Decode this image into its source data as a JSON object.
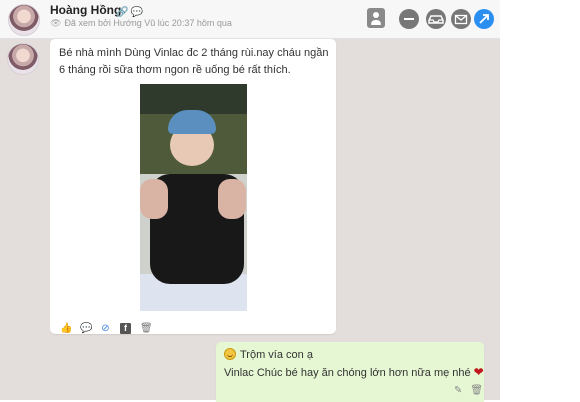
{
  "header": {
    "name": "Hoàng Hồng",
    "seen_text": "Đã xem bởi Hướng Vũ lúc 20:37 hôm qua",
    "icons": {
      "link": "link-icon",
      "contact_card": "contact-card-icon",
      "minus": "minus-icon",
      "inbox": "inbox-icon",
      "mail": "mail-icon",
      "open": "open-external-icon"
    }
  },
  "messages": {
    "incoming": {
      "text": "Bé nhà mình Dùng Vinlac đc 2 tháng rùi.nay cháu ngần 6 tháng rồi sữa thơm ngon rề uống bé rất thích.",
      "actions": [
        "like-icon",
        "comment-icon",
        "hide-icon",
        "facebook-icon",
        "trash-icon"
      ]
    },
    "outgoing": {
      "line1": "Trộm vía con ạ",
      "line2": "Vinlac Chúc bé hay ăn chóng lớn hơn nữa mẹ nhé",
      "actions": [
        "edit-icon",
        "trash-icon"
      ]
    }
  },
  "colors": {
    "chat_bg": "#e3dedb",
    "outgoing_bubble": "#e6f7d3",
    "accent_blue": "#2a8ff0"
  }
}
